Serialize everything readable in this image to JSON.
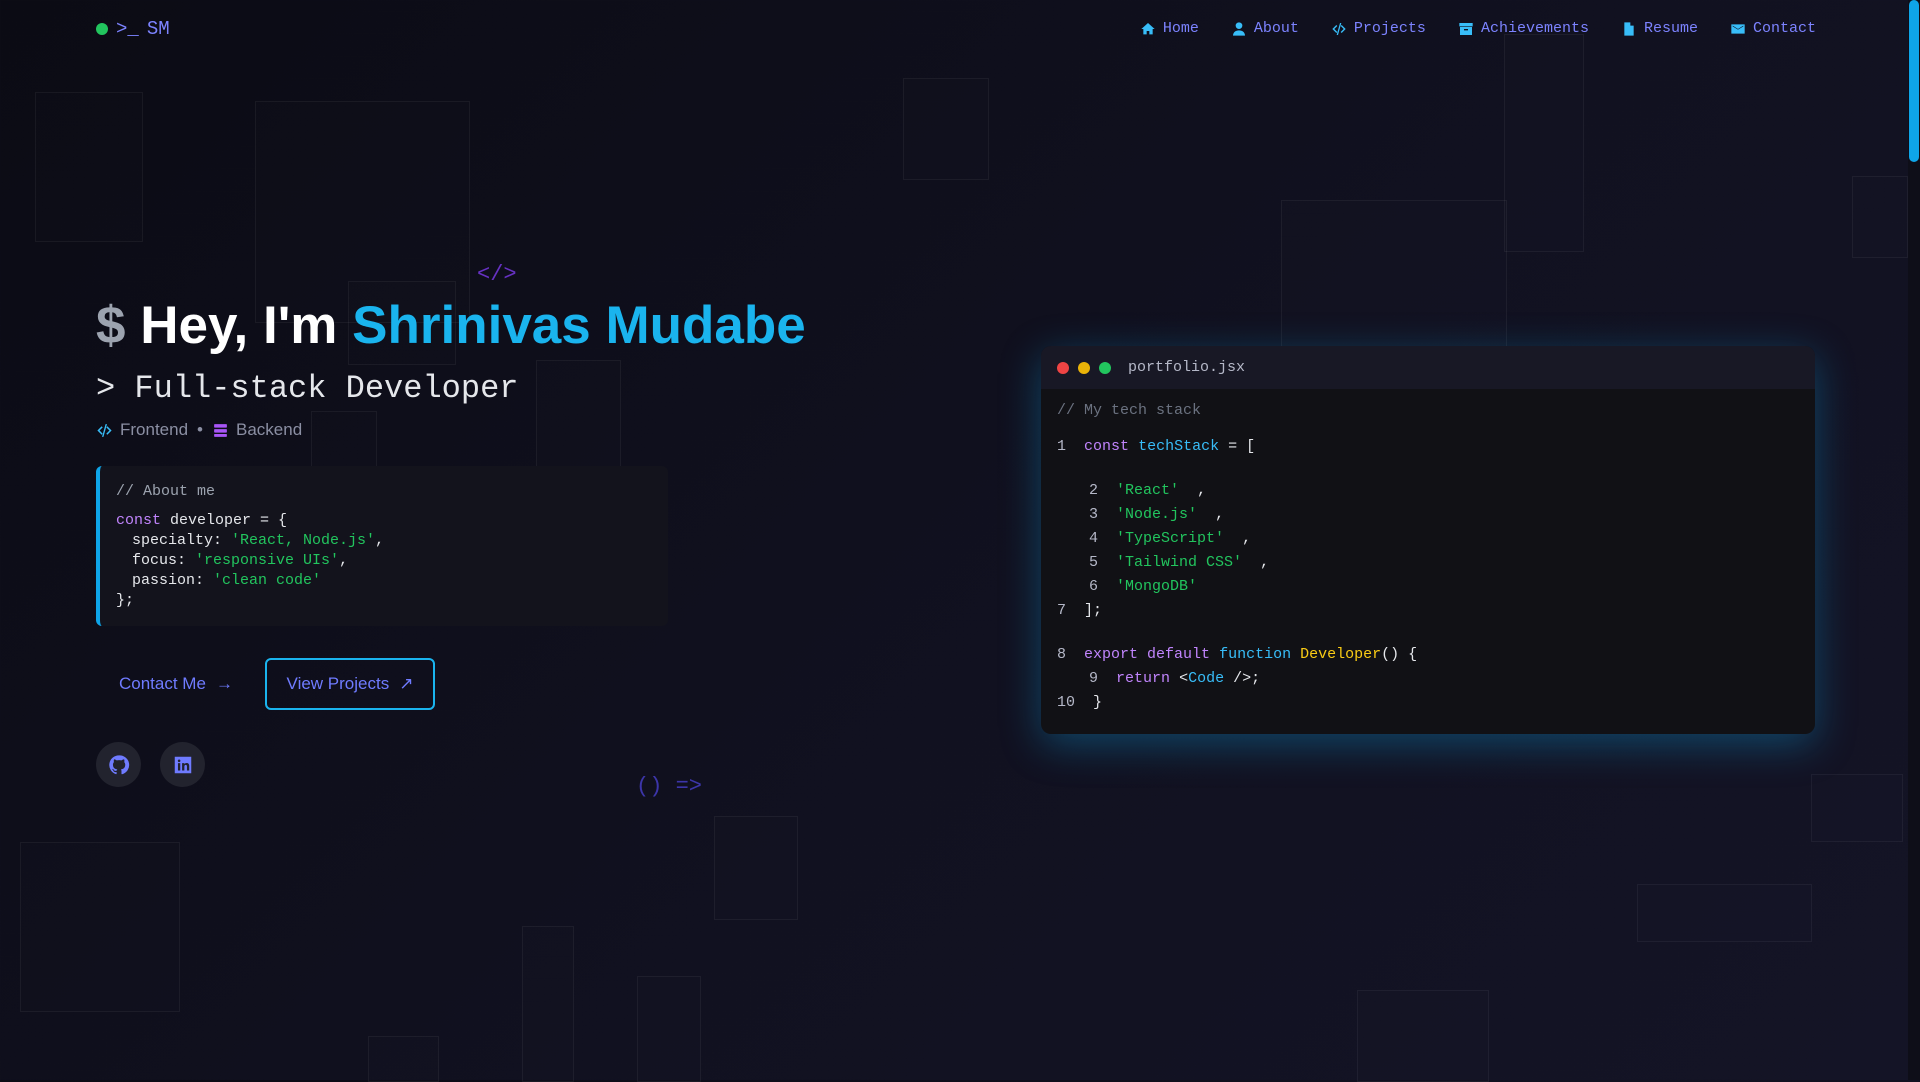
{
  "nav": {
    "logo_prompt": ">_",
    "logo_initials": "SM",
    "items": [
      {
        "label": "Home",
        "icon": "home-icon"
      },
      {
        "label": "About",
        "icon": "user-icon"
      },
      {
        "label": "Projects",
        "icon": "code-icon"
      },
      {
        "label": "Achievements",
        "icon": "archive-icon"
      },
      {
        "label": "Resume",
        "icon": "file-icon"
      },
      {
        "label": "Contact",
        "icon": "envelope-icon"
      }
    ]
  },
  "hero": {
    "deco_top": "</>",
    "deco_bottom": "() =>",
    "prompt": "$",
    "greeting": "Hey, I'm",
    "name": "Shrinivas Mudabe",
    "role": "> Full-stack Developer",
    "stack": {
      "frontend": "Frontend",
      "separator": "•",
      "backend": "Backend"
    }
  },
  "about_code": {
    "comment": "// About me",
    "kw": "const",
    "var": "developer = {",
    "specialty_key": "specialty:",
    "specialty_val": "'React, Node.js'",
    "focus_key": "focus:",
    "focus_val": "'responsive UIs'",
    "passion_key": "passion:",
    "passion_val": "'clean code'",
    "comma": ",",
    "close": "};"
  },
  "buttons": {
    "contact": "Contact Me",
    "contact_arrow": "→",
    "projects": "View Projects",
    "projects_arrow": "↗"
  },
  "social": [
    {
      "name": "github",
      "icon": "github-icon"
    },
    {
      "name": "linkedin",
      "icon": "linkedin-icon"
    }
  ],
  "editor": {
    "filename": "portfolio.jsx",
    "comment": "// My tech stack",
    "n1": "1",
    "n2": "2",
    "n3": "3",
    "n4": "4",
    "n5": "5",
    "n6": "6",
    "n7": "7",
    "n8": "8",
    "n9": "9",
    "n10": "10",
    "kw_const": "const",
    "var_name": "techStack",
    "assign": " = [",
    "items": [
      "'React'",
      "'Node.js'",
      "'TypeScript'",
      "'Tailwind CSS'",
      "'MongoDB'"
    ],
    "comma": ",",
    "close_arr": "];",
    "kw_export": "export default",
    "kw_function": "function",
    "fn_name": "Developer",
    "fn_sig": "() {",
    "kw_return": "return",
    "tag_open": "<",
    "tag_name": "Code",
    "tag_close": " />;",
    "close_fn": "}"
  },
  "colors": {
    "accent": "#1ab4ee",
    "link": "#7c83ff",
    "string": "#22c55e",
    "keyword": "#c084fc",
    "dot_red": "#ef4444",
    "dot_yellow": "#eab308",
    "dot_green": "#22c55e"
  }
}
